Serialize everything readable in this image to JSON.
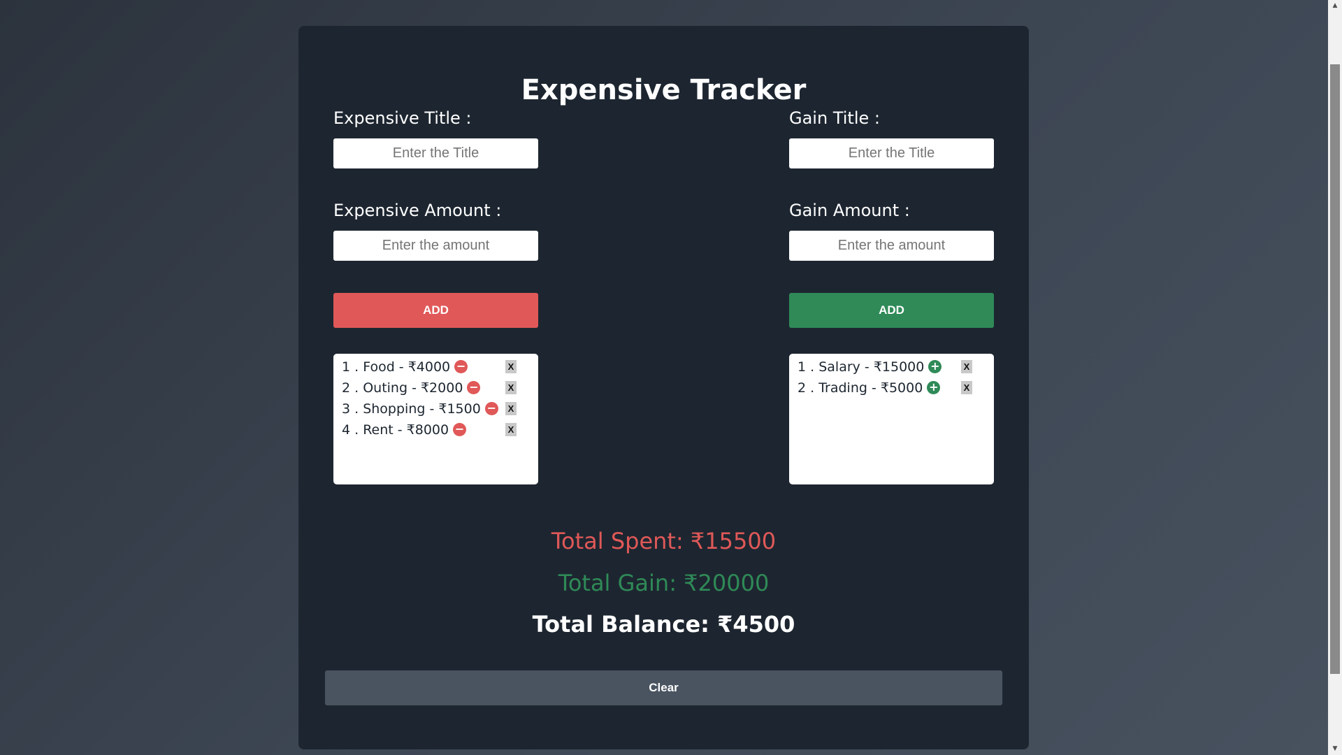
{
  "app": {
    "title": "Expensive Tracker"
  },
  "expense": {
    "title_label": "Expensive Title :",
    "title_placeholder": "Enter the Title",
    "amount_label": "Expensive Amount :",
    "amount_placeholder": "Enter the amount",
    "add_label": "ADD",
    "items": [
      {
        "text": "1 . Food - ₹4000"
      },
      {
        "text": "2 . Outing - ₹2000"
      },
      {
        "text": "3 . Shopping - ₹1500"
      },
      {
        "text": "4 . Rent - ₹8000"
      }
    ],
    "remove_label": "X",
    "icon_glyph": "−"
  },
  "gain": {
    "title_label": "Gain Title :",
    "title_placeholder": "Enter the Title",
    "amount_label": "Gain Amount :",
    "amount_placeholder": "Enter the amount",
    "add_label": "ADD",
    "items": [
      {
        "text": "1 . Salary - ₹15000"
      },
      {
        "text": "2 . Trading - ₹5000"
      }
    ],
    "remove_label": "X",
    "icon_glyph": "+"
  },
  "totals": {
    "spent": "Total Spent: ₹15500",
    "gain": "Total Gain: ₹20000",
    "balance": "Total Balance: ₹4500"
  },
  "clear_label": "Clear",
  "colors": {
    "expense_accent": "#e05858",
    "gain_accent": "#2f8a57",
    "panel": "#1d2630",
    "clear_button": "#4a5461"
  },
  "icons": {
    "expense_item": "minus-circle-icon",
    "gain_item": "plus-circle-icon",
    "scroll_up": "scroll-up-arrow-icon",
    "scroll_down": "scroll-down-arrow-icon"
  }
}
